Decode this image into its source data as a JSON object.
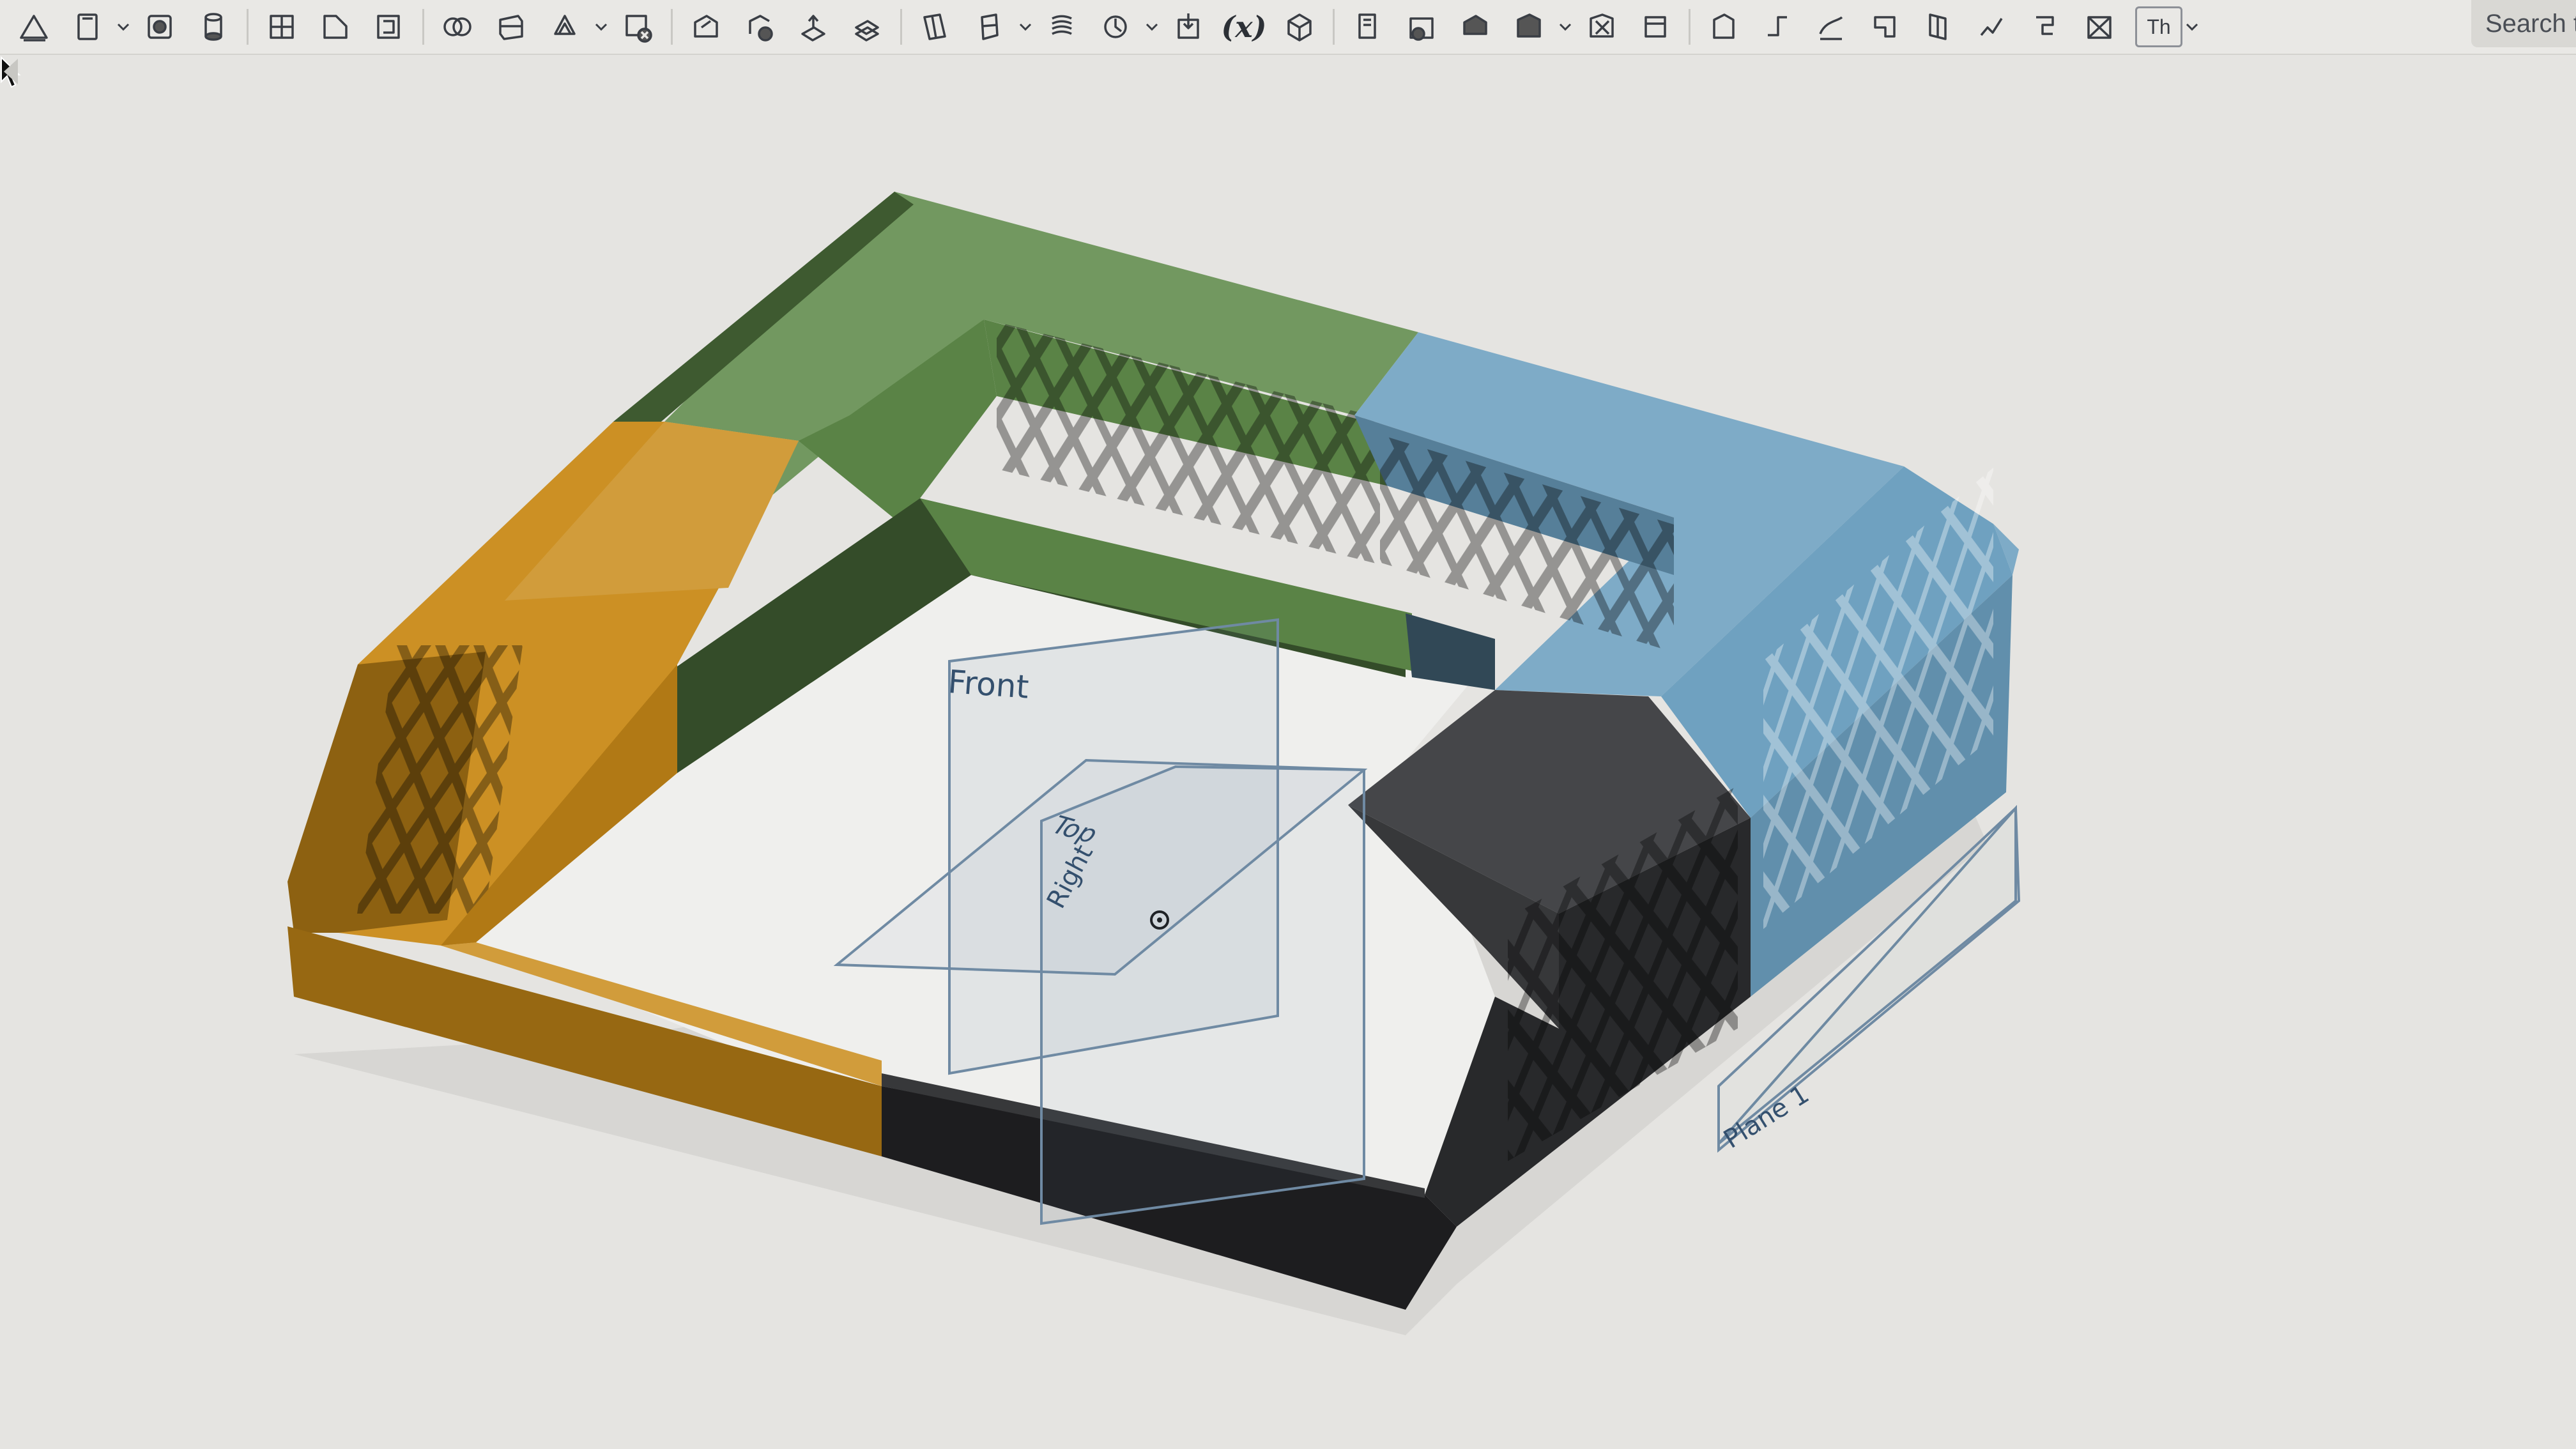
{
  "toolbar": {
    "groups": [
      [
        "sketch-icon",
        "extrude-icon",
        "revolve-icon",
        "sweep-icon"
      ],
      [
        "fillet-icon",
        "chamfer-icon",
        "shell-icon"
      ],
      [
        "boolean-icon",
        "split-icon",
        "transform-icon",
        "delete-part-icon"
      ],
      [
        "move-face-icon",
        "replace-face-icon",
        "offset-surface-icon",
        "thicken-icon"
      ],
      [
        "plane-icon",
        "mate-connector-icon",
        "helix-icon",
        "fit-spline-icon",
        "import-icon",
        "variable-icon",
        "derived-icon"
      ],
      [
        "sheet-metal-icon",
        "flange-icon",
        "hem-icon",
        "tab-icon",
        "corner-icon",
        "bend-relief-icon"
      ],
      [
        "frame-icon",
        "trim-icon",
        "gusset-icon",
        "end-cap-icon",
        "cut-list-icon",
        "tube-icon",
        "rib-icon",
        "section-icon"
      ]
    ],
    "variable_label": "(x)",
    "custom_feature_label": "Th",
    "search_label": "Search t"
  },
  "viewport": {
    "plane_labels": {
      "front": "Front",
      "top": "Top",
      "right": "Right",
      "plane1": "Plane 1"
    },
    "part_colors": {
      "green": "#5f8a4a",
      "blue": "#6c9fbf",
      "orange": "#c98a18",
      "black": "#2c2d30",
      "plane": "#6f8aa3"
    }
  }
}
